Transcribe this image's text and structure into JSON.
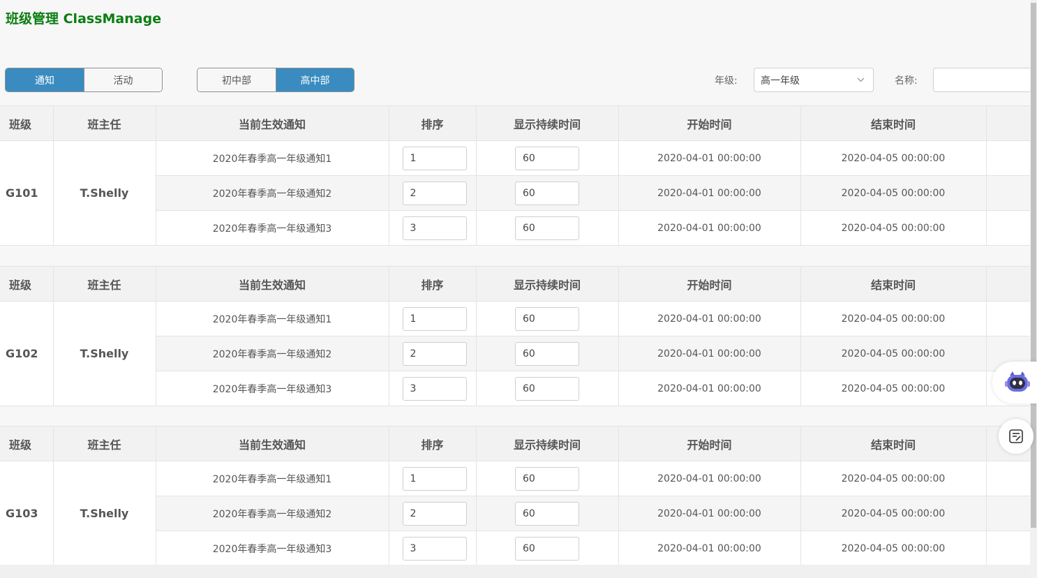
{
  "app": {
    "title": "班级管理 ClassManage"
  },
  "toolbar": {
    "type_tabs": [
      {
        "label": "通知",
        "active": true
      },
      {
        "label": "活动",
        "active": false
      }
    ],
    "dept_tabs": [
      {
        "label": "初中部",
        "active": false
      },
      {
        "label": "高中部",
        "active": true
      }
    ],
    "grade_label": "年级:",
    "grade_value": "高一年级",
    "name_label": "名称:",
    "name_value": ""
  },
  "table_headers": [
    "班级",
    "班主任",
    "当前生效通知",
    "排序",
    "显示持续时间",
    "开始时间",
    "结束时间",
    ""
  ],
  "groups": [
    {
      "class": "G101",
      "teacher": "T.Shelly",
      "rows": [
        {
          "notice": "2020年春季高一年级通知1",
          "order": "1",
          "duration": "60",
          "start": "2020-04-01 00:00:00",
          "end": "2020-04-05 00:00:00"
        },
        {
          "notice": "2020年春季高一年级通知2",
          "order": "2",
          "duration": "60",
          "start": "2020-04-01 00:00:00",
          "end": "2020-04-05 00:00:00"
        },
        {
          "notice": "2020年春季高一年级通知3",
          "order": "3",
          "duration": "60",
          "start": "2020-04-01 00:00:00",
          "end": "2020-04-05 00:00:00"
        }
      ]
    },
    {
      "class": "G102",
      "teacher": "T.Shelly",
      "rows": [
        {
          "notice": "2020年春季高一年级通知1",
          "order": "1",
          "duration": "60",
          "start": "2020-04-01 00:00:00",
          "end": "2020-04-05 00:00:00"
        },
        {
          "notice": "2020年春季高一年级通知2",
          "order": "2",
          "duration": "60",
          "start": "2020-04-01 00:00:00",
          "end": "2020-04-05 00:00:00"
        },
        {
          "notice": "2020年春季高一年级通知3",
          "order": "3",
          "duration": "60",
          "start": "2020-04-01 00:00:00",
          "end": "2020-04-05 00:00:00"
        }
      ]
    },
    {
      "class": "G103",
      "teacher": "T.Shelly",
      "rows": [
        {
          "notice": "2020年春季高一年级通知1",
          "order": "1",
          "duration": "60",
          "start": "2020-04-01 00:00:00",
          "end": "2020-04-05 00:00:00"
        },
        {
          "notice": "2020年春季高一年级通知2",
          "order": "2",
          "duration": "60",
          "start": "2020-04-01 00:00:00",
          "end": "2020-04-05 00:00:00"
        },
        {
          "notice": "2020年春季高一年级通知3",
          "order": "3",
          "duration": "60",
          "start": "2020-04-01 00:00:00",
          "end": "2020-04-05 00:00:00"
        }
      ]
    }
  ],
  "floating": {
    "assistant_icon": "robot-assistant-icon",
    "notes_icon": "notes-icon"
  },
  "colors": {
    "title": "#0a7d12",
    "accent": "#3a8cc0"
  }
}
